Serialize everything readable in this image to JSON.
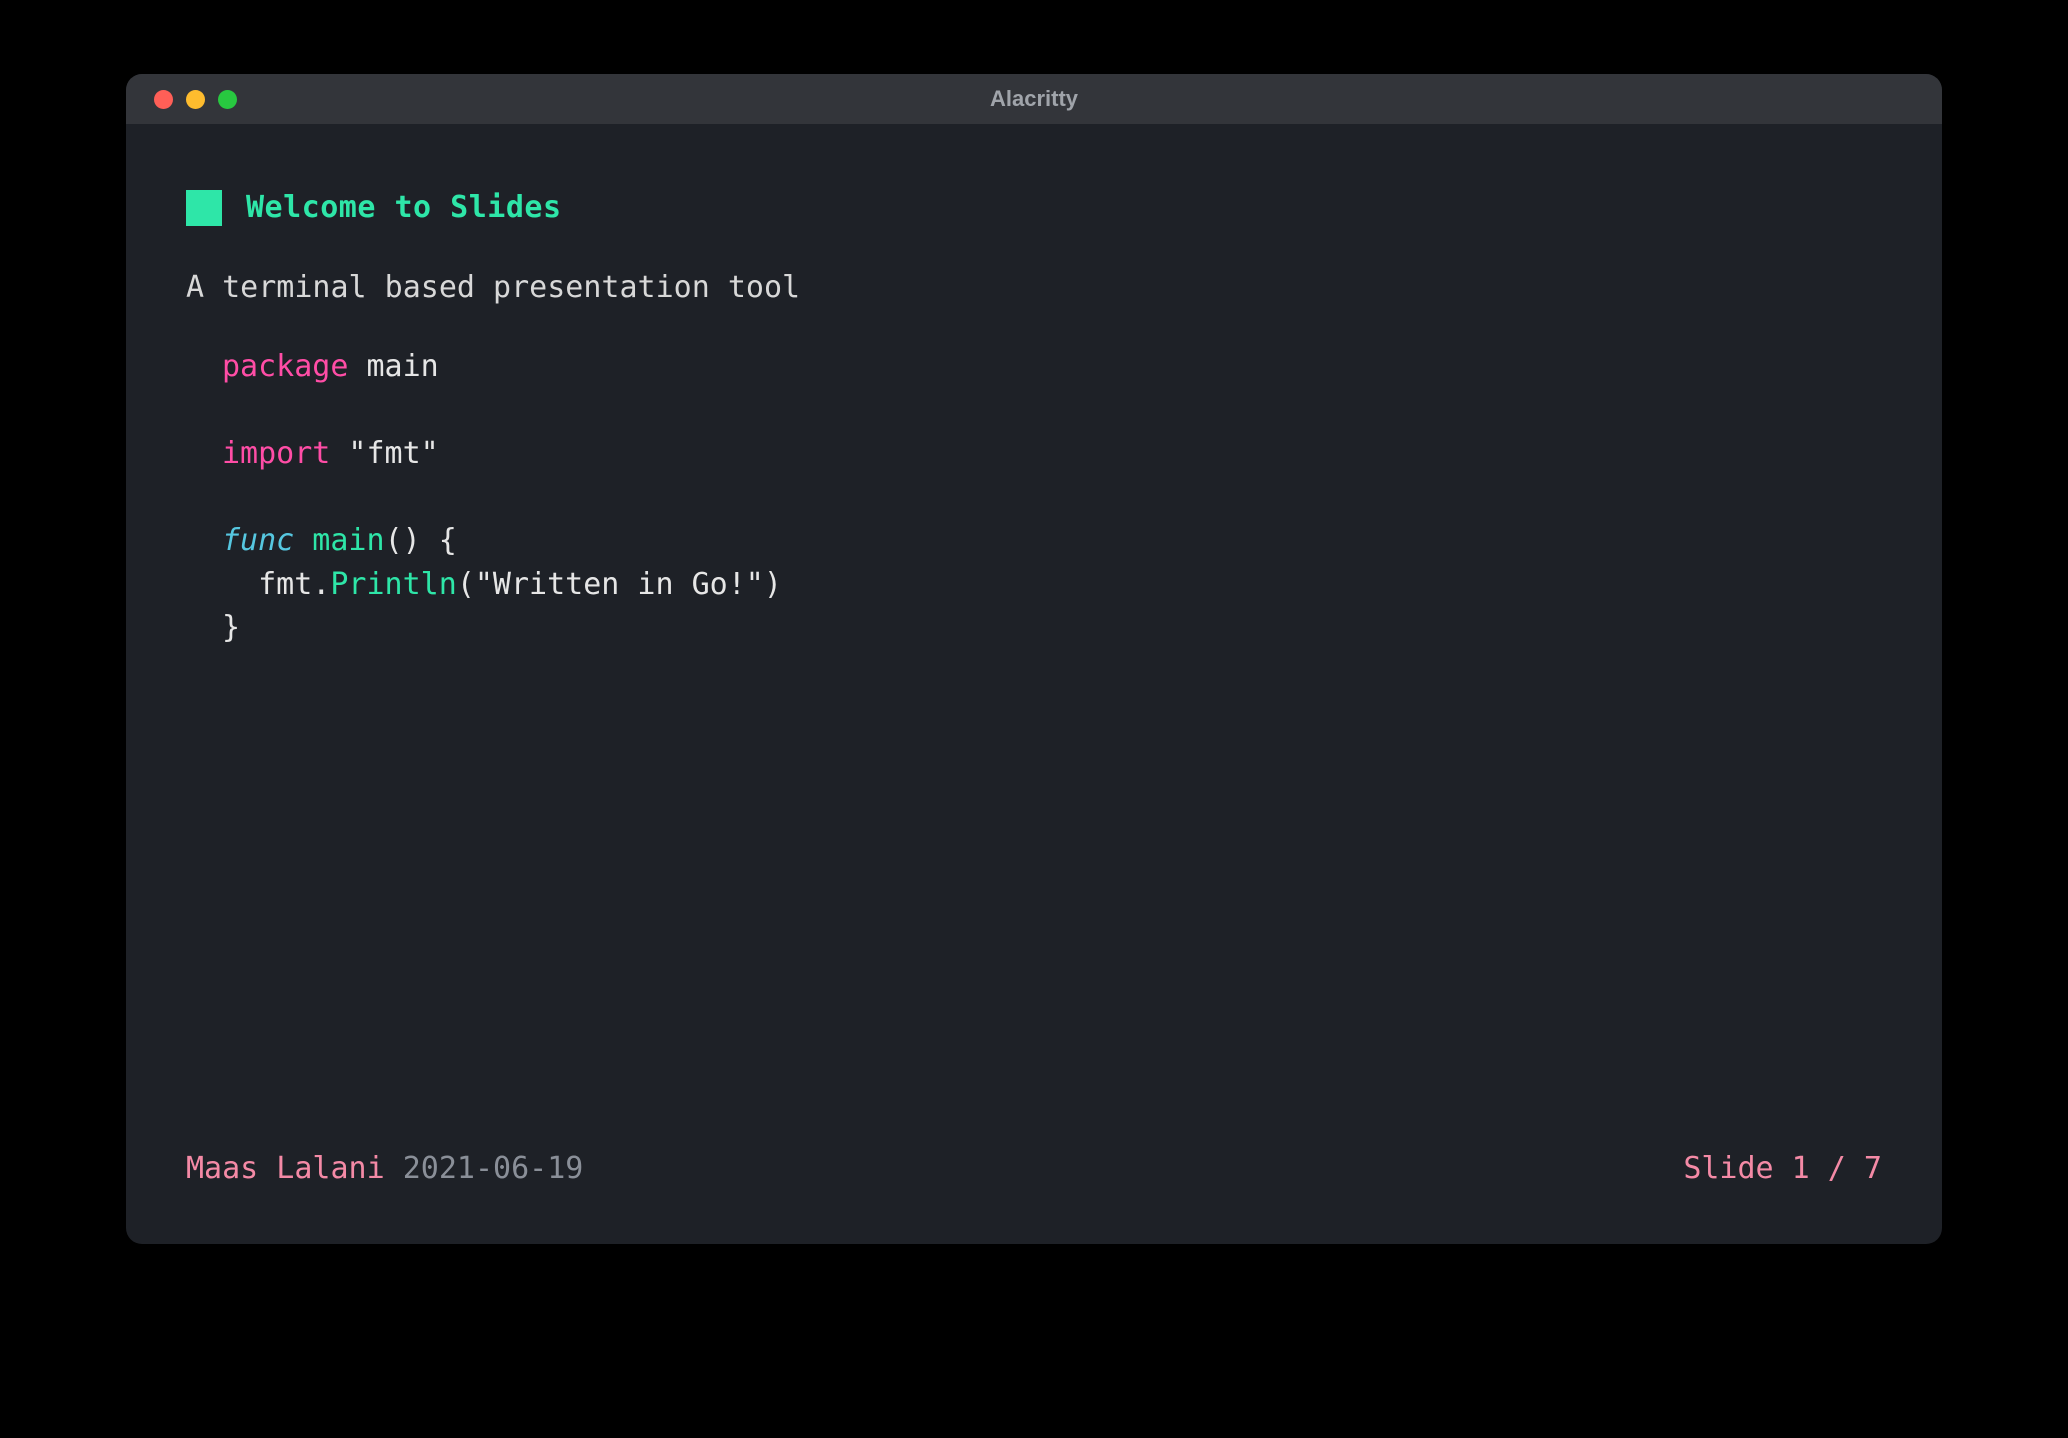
{
  "window": {
    "title": "Alacritty"
  },
  "slide": {
    "heading": "Welcome to Slides",
    "subtitle": "A terminal based presentation tool",
    "code": {
      "line1_kw": "package",
      "line1_rest": " main",
      "line2_kw": "import",
      "line2_rest": " \"fmt\"",
      "line3_kw": "func",
      "line3_fn": " main",
      "line3_rest": "() {",
      "line4_indent": "  fmt.",
      "line4_fn": "Println",
      "line4_paren_open": "(",
      "line4_str": "\"Written in Go!\"",
      "line4_paren_close": ")",
      "line5": "}"
    }
  },
  "footer": {
    "author": "Maas Lalani",
    "date": "2021-06-19",
    "slide_label": "Slide 1 / 7"
  }
}
